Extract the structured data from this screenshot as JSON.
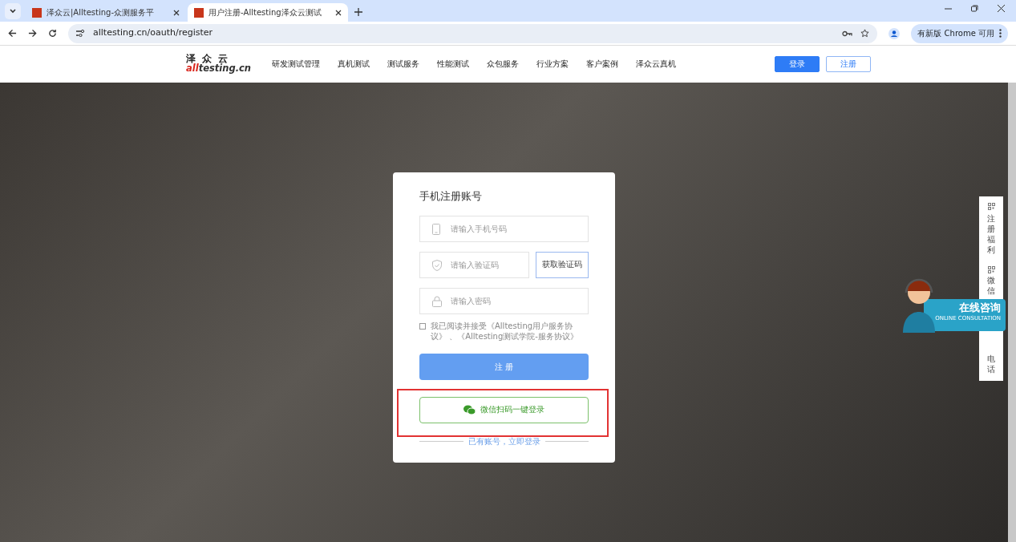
{
  "browser": {
    "tabs": [
      {
        "title": "泽众云|Alltesting-众测服务平",
        "selected": false
      },
      {
        "title": "用户注册-Alltesting泽众云测试",
        "selected": true
      }
    ],
    "url": "alltesting.cn/oauth/register",
    "update_chip": "有新版 Chrome 可用"
  },
  "site": {
    "logo_cn": "泽 众 云",
    "logo_en": [
      "all",
      "testing.cn"
    ],
    "nav": [
      "研发测试管理",
      "真机测试",
      "测试服务",
      "性能测试",
      "众包服务",
      "行业方案",
      "客户案例",
      "泽众云真机"
    ],
    "login": "登录",
    "register": "注册"
  },
  "form": {
    "title": "手机注册账号",
    "fields": [
      {
        "kind": "phone",
        "placeholder": "请输入手机号码"
      },
      {
        "kind": "code",
        "placeholder": "请输入验证码"
      },
      {
        "kind": "password",
        "placeholder": "请输入密码"
      }
    ],
    "code_button": "获取验证码",
    "agree": {
      "checked": false,
      "text": "我已阅读并接受《Alltesting用户服务协议》 、《Alltesting测试学院-服务协议》"
    },
    "submit": "注 册",
    "wechat": "微信扫码一键登录",
    "login_link": "已有账号，立即登录"
  },
  "side": {
    "items": [
      "注册福利",
      "微信",
      "电话"
    ]
  },
  "consult": {
    "title": "在线咨询",
    "subtitle": "ONLINE CONSULTATION"
  }
}
